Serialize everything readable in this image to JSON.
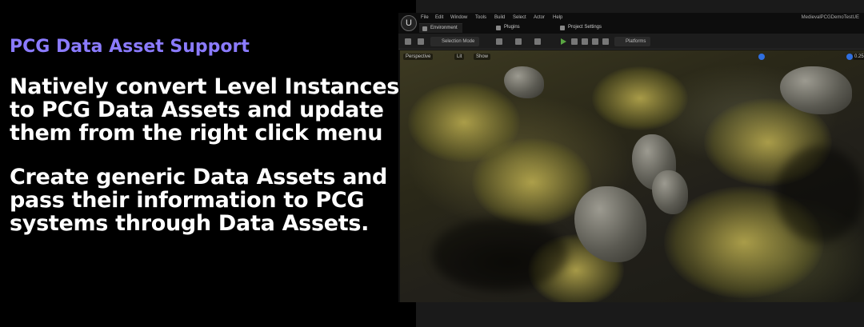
{
  "slide": {
    "kicker": "PCG Data Asset Support",
    "paragraph1": "Natively convert Level Instances to PCG Data Assets and update them from the right click menu",
    "paragraph2": "Create generic Data Assets and pass their information to PCG systems through Data Assets.",
    "kicker_color": "#8b7bff"
  },
  "editor": {
    "logo": "U",
    "menu": [
      "File",
      "Edit",
      "Window",
      "Tools",
      "Build",
      "Select",
      "Actor",
      "Help"
    ],
    "project_name": "MedievalPCGDemoTestUE",
    "tabs": [
      "Environment",
      "Plugins",
      "Project Settings"
    ],
    "toolbar": {
      "selection_mode": "Selection Mode",
      "platforms": "Platforms"
    },
    "viewport": {
      "perspective": "Perspective",
      "lit": "Lit",
      "show": "Show",
      "right_value": "0.25"
    }
  }
}
